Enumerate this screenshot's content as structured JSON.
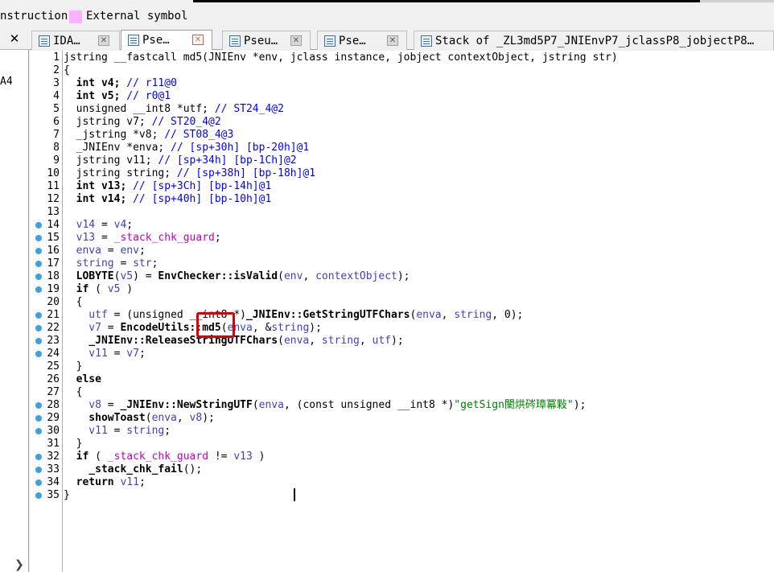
{
  "legend": {
    "instruction_label": "nstruction",
    "external_label": "External symbol"
  },
  "left_panel": {
    "close_label": "✕",
    "addr_fragment": "A4",
    "scroll_arrow": "❯"
  },
  "tabs": [
    {
      "label": "IDA…",
      "close": "✕"
    },
    {
      "label": "Pse…",
      "close": "✕"
    },
    {
      "label": "Pseu…",
      "close": "✕"
    },
    {
      "label": "Pse…",
      "close": "✕"
    },
    {
      "label": "Stack of _ZL3md5P7_JNIEnvP7_jclassP8_jobjectP8…"
    }
  ],
  "code_lines": [
    {
      "n": "1",
      "dot": false,
      "parts": [
        [
          "",
          "jstring __fastcall md5(JNIEnv *env, jclass instance, jobject contextObject, jstring str)"
        ]
      ]
    },
    {
      "n": "2",
      "dot": false,
      "parts": [
        [
          "",
          "{"
        ]
      ]
    },
    {
      "n": "3",
      "dot": false,
      "parts": [
        [
          "k",
          "  int v4; "
        ],
        [
          "c",
          "// r11@0"
        ]
      ]
    },
    {
      "n": "4",
      "dot": false,
      "parts": [
        [
          "k",
          "  int v5; "
        ],
        [
          "c",
          "// r0@1"
        ]
      ]
    },
    {
      "n": "5",
      "dot": false,
      "parts": [
        [
          "",
          "  unsigned __int8 *utf; "
        ],
        [
          "c",
          "// ST24_4@2"
        ]
      ]
    },
    {
      "n": "6",
      "dot": false,
      "parts": [
        [
          "",
          "  jstring v7; "
        ],
        [
          "c",
          "// ST20_4@2"
        ]
      ]
    },
    {
      "n": "7",
      "dot": false,
      "parts": [
        [
          "",
          "  _jstring *v8; "
        ],
        [
          "c",
          "// ST08_4@3"
        ]
      ]
    },
    {
      "n": "8",
      "dot": false,
      "parts": [
        [
          "",
          "  _JNIEnv *enva; "
        ],
        [
          "c",
          "// [sp+30h] [bp-20h]@1"
        ]
      ]
    },
    {
      "n": "9",
      "dot": false,
      "parts": [
        [
          "",
          "  jstring v11; "
        ],
        [
          "c",
          "// [sp+34h] [bp-1Ch]@2"
        ]
      ]
    },
    {
      "n": "10",
      "dot": false,
      "parts": [
        [
          "",
          "  jstring string; "
        ],
        [
          "c",
          "// [sp+38h] [bp-18h]@1"
        ]
      ]
    },
    {
      "n": "11",
      "dot": false,
      "parts": [
        [
          "k",
          "  int v13; "
        ],
        [
          "c",
          "// [sp+3Ch] [bp-14h]@1"
        ]
      ]
    },
    {
      "n": "12",
      "dot": false,
      "parts": [
        [
          "k",
          "  int v14; "
        ],
        [
          "c",
          "// [sp+40h] [bp-10h]@1"
        ]
      ]
    },
    {
      "n": "13",
      "dot": false,
      "parts": [
        [
          "",
          ""
        ]
      ]
    },
    {
      "n": "14",
      "dot": true,
      "parts": [
        [
          "v",
          "  v14"
        ],
        [
          "",
          " = "
        ],
        [
          "v",
          "v4"
        ],
        [
          "",
          ";"
        ]
      ]
    },
    {
      "n": "15",
      "dot": true,
      "parts": [
        [
          "v",
          "  v13"
        ],
        [
          "",
          " = "
        ],
        [
          "m",
          "_stack_chk_guard"
        ],
        [
          "",
          ";"
        ]
      ]
    },
    {
      "n": "16",
      "dot": true,
      "parts": [
        [
          "v",
          "  enva"
        ],
        [
          "",
          " = "
        ],
        [
          "v",
          "env"
        ],
        [
          "",
          ";"
        ]
      ]
    },
    {
      "n": "17",
      "dot": true,
      "parts": [
        [
          "v",
          "  string"
        ],
        [
          "",
          " = "
        ],
        [
          "v",
          "str"
        ],
        [
          "",
          ";"
        ]
      ]
    },
    {
      "n": "18",
      "dot": true,
      "parts": [
        [
          "bold",
          "  LOBYTE"
        ],
        [
          "",
          "("
        ],
        [
          "v",
          "v5"
        ],
        [
          "",
          ") = "
        ],
        [
          "bold",
          "EnvChecker::isValid"
        ],
        [
          "",
          "("
        ],
        [
          "v",
          "env"
        ],
        [
          "",
          ", "
        ],
        [
          "v",
          "contextObject"
        ],
        [
          "",
          ");"
        ]
      ]
    },
    {
      "n": "19",
      "dot": true,
      "parts": [
        [
          "k",
          "  if"
        ],
        [
          "",
          " ( "
        ],
        [
          "v",
          "v5"
        ],
        [
          "",
          " )"
        ]
      ]
    },
    {
      "n": "20",
      "dot": false,
      "parts": [
        [
          "",
          "  {"
        ]
      ]
    },
    {
      "n": "21",
      "dot": true,
      "parts": [
        [
          "v",
          "    utf"
        ],
        [
          "",
          " = (unsigned __int8 *)"
        ],
        [
          "bold",
          "_JNIEnv::GetStringUTFChars"
        ],
        [
          "",
          "("
        ],
        [
          "v",
          "enva"
        ],
        [
          "",
          ", "
        ],
        [
          "v",
          "string"
        ],
        [
          "",
          ", 0);"
        ]
      ]
    },
    {
      "n": "22",
      "dot": true,
      "parts": [
        [
          "v",
          "    v7"
        ],
        [
          "",
          " = "
        ],
        [
          "bold",
          "EncodeUtils::md5"
        ],
        [
          "",
          "("
        ],
        [
          "v",
          "enva"
        ],
        [
          "",
          ", &"
        ],
        [
          "v",
          "string"
        ],
        [
          "",
          ");"
        ]
      ]
    },
    {
      "n": "23",
      "dot": true,
      "parts": [
        [
          "bold",
          "    _JNIEnv::ReleaseStringUTFChars"
        ],
        [
          "",
          "("
        ],
        [
          "v",
          "enva"
        ],
        [
          "",
          ", "
        ],
        [
          "v",
          "string"
        ],
        [
          "",
          ", "
        ],
        [
          "v",
          "utf"
        ],
        [
          "",
          ");"
        ]
      ]
    },
    {
      "n": "24",
      "dot": true,
      "parts": [
        [
          "v",
          "    v11"
        ],
        [
          "",
          " = "
        ],
        [
          "v",
          "v7"
        ],
        [
          "",
          ";"
        ]
      ]
    },
    {
      "n": "25",
      "dot": false,
      "parts": [
        [
          "",
          "  }"
        ]
      ]
    },
    {
      "n": "26",
      "dot": false,
      "parts": [
        [
          "k",
          "  else"
        ]
      ]
    },
    {
      "n": "27",
      "dot": false,
      "parts": [
        [
          "",
          "  {"
        ]
      ]
    },
    {
      "n": "28",
      "dot": true,
      "parts": [
        [
          "v",
          "    v8"
        ],
        [
          "",
          " = "
        ],
        [
          "bold",
          "_JNIEnv::NewStringUTF"
        ],
        [
          "",
          "("
        ],
        [
          "v",
          "enva"
        ],
        [
          "",
          ", (const unsigned __int8 *)"
        ],
        [
          "s",
          "\"getSign闉烘硶璋冪敤\""
        ],
        [
          "",
          ");"
        ]
      ]
    },
    {
      "n": "29",
      "dot": true,
      "parts": [
        [
          "bold",
          "    showToast"
        ],
        [
          "",
          "("
        ],
        [
          "v",
          "enva"
        ],
        [
          "",
          ", "
        ],
        [
          "v",
          "v8"
        ],
        [
          "",
          ");"
        ]
      ]
    },
    {
      "n": "30",
      "dot": true,
      "parts": [
        [
          "v",
          "    v11"
        ],
        [
          "",
          " = "
        ],
        [
          "v",
          "string"
        ],
        [
          "",
          ";"
        ]
      ]
    },
    {
      "n": "31",
      "dot": false,
      "parts": [
        [
          "",
          "  }"
        ]
      ]
    },
    {
      "n": "32",
      "dot": true,
      "parts": [
        [
          "k",
          "  if"
        ],
        [
          "",
          " ( "
        ],
        [
          "m",
          "_stack_chk_guard"
        ],
        [
          "",
          " != "
        ],
        [
          "v",
          "v13"
        ],
        [
          "",
          " )"
        ]
      ]
    },
    {
      "n": "33",
      "dot": true,
      "parts": [
        [
          "bold",
          "    _stack_chk_fail"
        ],
        [
          "",
          "();"
        ]
      ]
    },
    {
      "n": "34",
      "dot": true,
      "parts": [
        [
          "k",
          "  return"
        ],
        [
          "",
          " "
        ],
        [
          "v",
          "v11"
        ],
        [
          "",
          ";"
        ]
      ]
    },
    {
      "n": "35",
      "dot": true,
      "parts": [
        [
          "",
          "}"
        ]
      ]
    }
  ]
}
